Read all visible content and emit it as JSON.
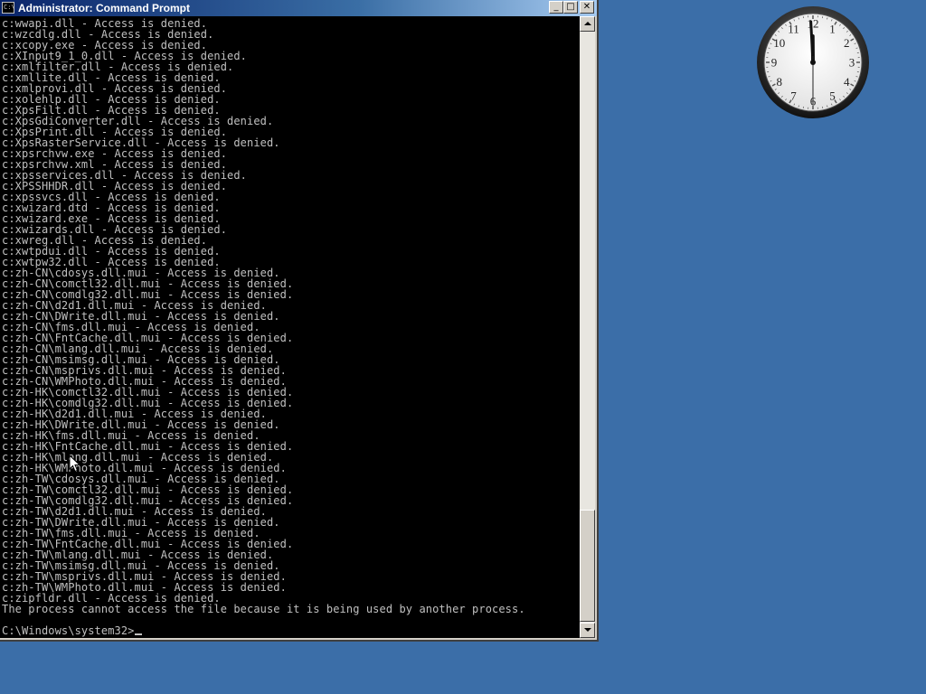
{
  "desktop": {
    "background_color": "#3b6ea8"
  },
  "window": {
    "title": "Administrator: Command Prompt",
    "icon_label": "C:\\",
    "controls": {
      "minimize": "_",
      "maximize": "□",
      "close": "✕"
    }
  },
  "console": {
    "lines": [
      "c:wwapi.dll - Access is denied.",
      "c:wzcdlg.dll - Access is denied.",
      "c:xcopy.exe - Access is denied.",
      "c:XInput9_1_0.dll - Access is denied.",
      "c:xmlfilter.dll - Access is denied.",
      "c:xmllite.dll - Access is denied.",
      "c:xmlprovi.dll - Access is denied.",
      "c:xolehlp.dll - Access is denied.",
      "c:XpsFilt.dll - Access is denied.",
      "c:XpsGdiConverter.dll - Access is denied.",
      "c:XpsPrint.dll - Access is denied.",
      "c:XpsRasterService.dll - Access is denied.",
      "c:xpsrchvw.exe - Access is denied.",
      "c:xpsrchvw.xml - Access is denied.",
      "c:xpsservices.dll - Access is denied.",
      "c:XPSSHHDR.dll - Access is denied.",
      "c:xpssvcs.dll - Access is denied.",
      "c:xwizard.dtd - Access is denied.",
      "c:xwizard.exe - Access is denied.",
      "c:xwizards.dll - Access is denied.",
      "c:xwreg.dll - Access is denied.",
      "c:xwtpdui.dll - Access is denied.",
      "c:xwtpw32.dll - Access is denied.",
      "c:zh-CN\\cdosys.dll.mui - Access is denied.",
      "c:zh-CN\\comctl32.dll.mui - Access is denied.",
      "c:zh-CN\\comdlg32.dll.mui - Access is denied.",
      "c:zh-CN\\d2d1.dll.mui - Access is denied.",
      "c:zh-CN\\DWrite.dll.mui - Access is denied.",
      "c:zh-CN\\fms.dll.mui - Access is denied.",
      "c:zh-CN\\FntCache.dll.mui - Access is denied.",
      "c:zh-CN\\mlang.dll.mui - Access is denied.",
      "c:zh-CN\\msimsg.dll.mui - Access is denied.",
      "c:zh-CN\\msprivs.dll.mui - Access is denied.",
      "c:zh-CN\\WMPhoto.dll.mui - Access is denied.",
      "c:zh-HK\\comctl32.dll.mui - Access is denied.",
      "c:zh-HK\\comdlg32.dll.mui - Access is denied.",
      "c:zh-HK\\d2d1.dll.mui - Access is denied.",
      "c:zh-HK\\DWrite.dll.mui - Access is denied.",
      "c:zh-HK\\fms.dll.mui - Access is denied.",
      "c:zh-HK\\FntCache.dll.mui - Access is denied.",
      "c:zh-HK\\mlang.dll.mui - Access is denied.",
      "c:zh-HK\\WMPhoto.dll.mui - Access is denied.",
      "c:zh-TW\\cdosys.dll.mui - Access is denied.",
      "c:zh-TW\\comctl32.dll.mui - Access is denied.",
      "c:zh-TW\\comdlg32.dll.mui - Access is denied.",
      "c:zh-TW\\d2d1.dll.mui - Access is denied.",
      "c:zh-TW\\DWrite.dll.mui - Access is denied.",
      "c:zh-TW\\fms.dll.mui - Access is denied.",
      "c:zh-TW\\FntCache.dll.mui - Access is denied.",
      "c:zh-TW\\mlang.dll.mui - Access is denied.",
      "c:zh-TW\\msimsg.dll.mui - Access is denied.",
      "c:zh-TW\\msprivs.dll.mui - Access is denied.",
      "c:zh-TW\\WMPhoto.dll.mui - Access is denied.",
      "c:zipfldr.dll - Access is denied.",
      "The process cannot access the file because it is being used by another process."
    ],
    "prompt": "C:\\Windows\\system32>"
  },
  "clock": {
    "numbers": [
      "12",
      "1",
      "2",
      "3",
      "4",
      "5",
      "6",
      "7",
      "8",
      "9",
      "10",
      "11"
    ],
    "time": "11:59:30"
  },
  "colors": {
    "console_bg": "#000000",
    "console_text": "#c0c0c0",
    "title_active": "#0a246a"
  }
}
